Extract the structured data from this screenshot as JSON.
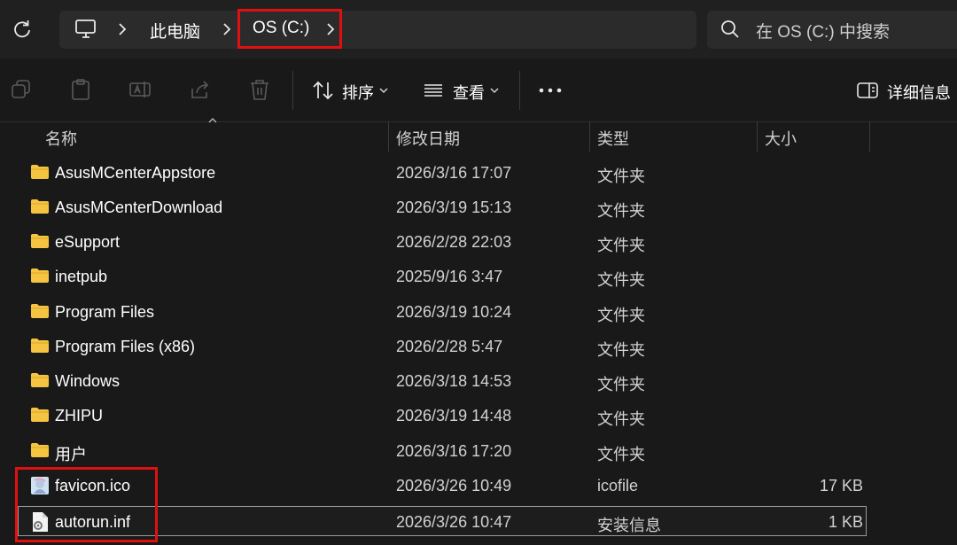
{
  "address": {
    "crumbs": [
      "此电脑",
      "OS (C:)"
    ]
  },
  "search": {
    "placeholder": "在 OS (C:) 中搜索"
  },
  "toolbar": {
    "sort_label": "排序",
    "view_label": "查看",
    "details_label": "详细信息"
  },
  "columns": {
    "name": "名称",
    "date": "修改日期",
    "type": "类型",
    "size": "大小"
  },
  "files": [
    {
      "name": "AsusMCenterAppstore",
      "date": "2026/3/16 17:07",
      "type": "文件夹",
      "size": "",
      "icon": "folder-icon"
    },
    {
      "name": "AsusMCenterDownload",
      "date": "2026/3/19 15:13",
      "type": "文件夹",
      "size": "",
      "icon": "folder-icon"
    },
    {
      "name": "eSupport",
      "date": "2026/2/28 22:03",
      "type": "文件夹",
      "size": "",
      "icon": "folder-icon"
    },
    {
      "name": "inetpub",
      "date": "2025/9/16 3:47",
      "type": "文件夹",
      "size": "",
      "icon": "folder-icon"
    },
    {
      "name": "Program Files",
      "date": "2026/3/19 10:24",
      "type": "文件夹",
      "size": "",
      "icon": "folder-icon"
    },
    {
      "name": "Program Files (x86)",
      "date": "2026/2/28 5:47",
      "type": "文件夹",
      "size": "",
      "icon": "folder-icon"
    },
    {
      "name": "Windows",
      "date": "2026/3/18 14:53",
      "type": "文件夹",
      "size": "",
      "icon": "folder-icon"
    },
    {
      "name": "ZHIPU",
      "date": "2026/3/19 14:48",
      "type": "文件夹",
      "size": "",
      "icon": "folder-icon"
    },
    {
      "name": "用户",
      "date": "2026/3/16 17:20",
      "type": "文件夹",
      "size": "",
      "icon": "folder-icon"
    },
    {
      "name": "favicon.ico",
      "date": "2026/3/26 10:49",
      "type": "icofile",
      "size": "17 KB",
      "icon": "image-file-icon"
    },
    {
      "name": "autorun.inf",
      "date": "2026/3/26 10:47",
      "type": "安装信息",
      "size": "1 KB",
      "icon": "settings-file-icon"
    }
  ],
  "colors": {
    "background": "#191919",
    "highlight": "#e01010",
    "folder": "#f5c542"
  }
}
